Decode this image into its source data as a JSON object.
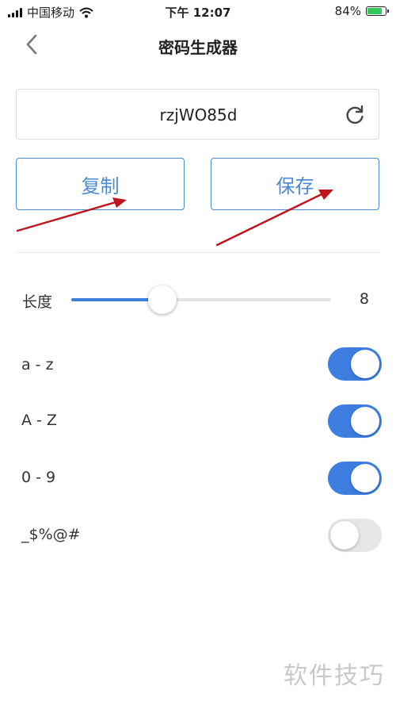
{
  "status_bar": {
    "carrier": "中国移动",
    "time": "下午 12:07",
    "battery_text": "84%",
    "battery_level": 0.84
  },
  "nav": {
    "title": "密码生成器",
    "back_icon": "chevron-left-icon"
  },
  "password": {
    "value": "rzjWO85d",
    "refresh_icon": "refresh-icon"
  },
  "actions": {
    "copy_label": "复制",
    "save_label": "保存"
  },
  "length": {
    "label": "长度",
    "value": "8",
    "slider_fraction": 0.35
  },
  "options": [
    {
      "label": "a - z",
      "enabled": true
    },
    {
      "label": "A - Z",
      "enabled": true
    },
    {
      "label": "0 - 9",
      "enabled": true
    },
    {
      "label": "_$%@#",
      "enabled": false
    }
  ],
  "watermark": "软件技巧",
  "colors": {
    "accent": "#3d7ee0",
    "button_border": "#4a8ad6",
    "arrow": "#c0141c",
    "battery": "#34c759"
  }
}
